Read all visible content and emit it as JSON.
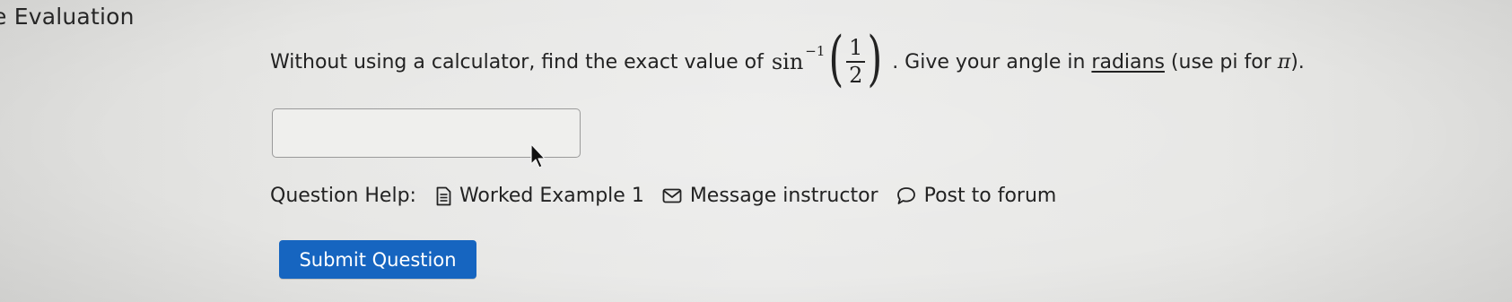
{
  "section": {
    "title": "e Evaluation"
  },
  "question": {
    "text_before": "Without using a calculator, find the exact value of",
    "function": "sin",
    "exponent": "−1",
    "open_paren": "(",
    "numerator": "1",
    "denominator": "2",
    "close_paren": ")",
    "text_after": ". Give your angle in ",
    "underlined_word": "radians",
    "text_end_1": " (use pi for ",
    "pi_symbol": "π",
    "text_end_2": ")."
  },
  "answer": {
    "value": "",
    "placeholder": ""
  },
  "help": {
    "label": "Question Help:",
    "worked_example": "Worked Example 1",
    "message_instructor": "Message instructor",
    "post_forum": "Post to forum"
  },
  "submit": {
    "label": "Submit Question"
  },
  "colors": {
    "primary_button": "#1665c0",
    "text": "#222222",
    "background": "#e8e8e6"
  },
  "icons": [
    "document-icon",
    "envelope-icon",
    "speech-bubble-icon",
    "mouse-pointer-icon"
  ]
}
